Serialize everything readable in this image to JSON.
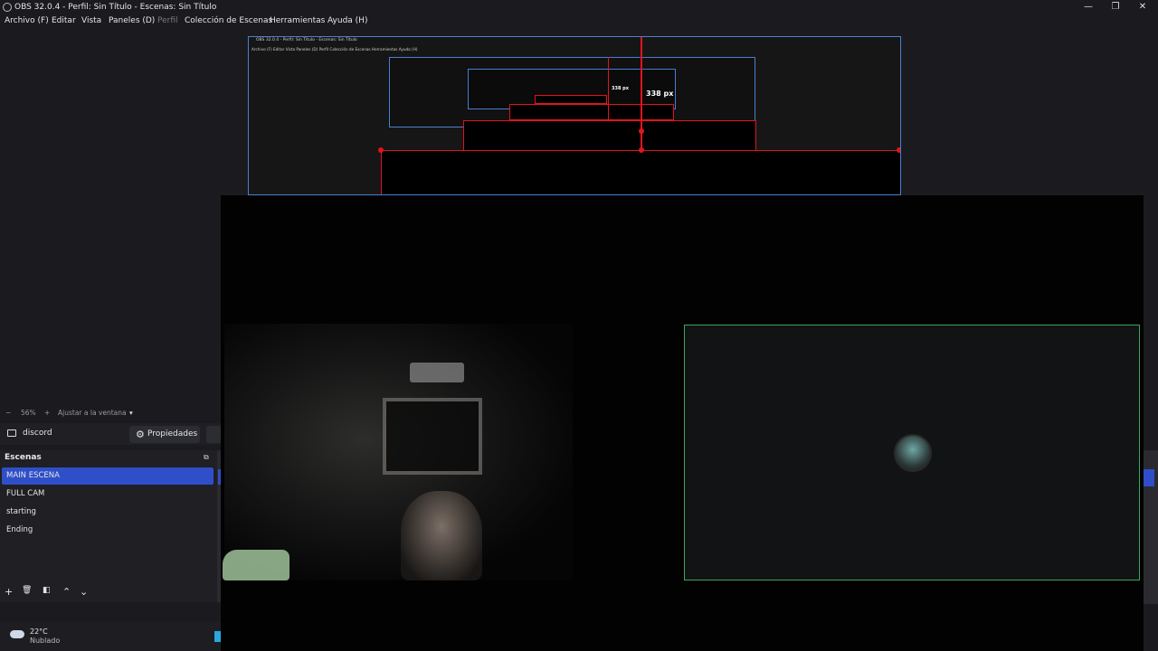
{
  "window": {
    "title": "OBS 32.0.4 - Perfil: Sin Título - Escenas: Sin Título",
    "controls": {
      "minimize": "—",
      "restore": "❐",
      "close": "✕"
    }
  },
  "menu": {
    "items": [
      "Archivo (F)",
      "Editar",
      "Vista",
      "Paneles (D)",
      "Perfil",
      "Colección de Escenas",
      "Herramientas",
      "Ayuda (H)"
    ]
  },
  "nested_preview": {
    "title": "OBS 32.0.4 - Perfil: Sin Título - Escenas: Sin Título",
    "menu": "Archivo (F)   Editar   Vista   Paneles (D)   Perfil   Colección de Escenas   Herramientas   Ayuda (H)",
    "measure_1": "338 px",
    "measure_2": "338 px"
  },
  "zoom": {
    "minus": "−",
    "value": "56%",
    "plus": "+",
    "fit_label": "Ajustar a la ventana",
    "dropdown": "▾"
  },
  "source_toolbar": {
    "source_name": "discord",
    "properties_label": "Propiedades",
    "properties_icon": "gear-icon"
  },
  "scenes": {
    "header": "Escenas",
    "items": [
      {
        "label": "MAIN ESCENA",
        "selected": true
      },
      {
        "label": "FULL CAM",
        "selected": false
      },
      {
        "label": "starting",
        "selected": false
      },
      {
        "label": "Ending",
        "selected": false
      }
    ],
    "tools": {
      "add": "+",
      "remove": "🗑",
      "filters": "◧",
      "up": "⌃",
      "down": "⌄"
    }
  },
  "taskbar": {
    "temperature": "22°C",
    "condition": "Nublado"
  },
  "colors": {
    "selection": "#2f4fc9",
    "discord_border": "#3ba55d",
    "guide_red": "#e0141e",
    "nested_border": "#4a7fd0"
  }
}
